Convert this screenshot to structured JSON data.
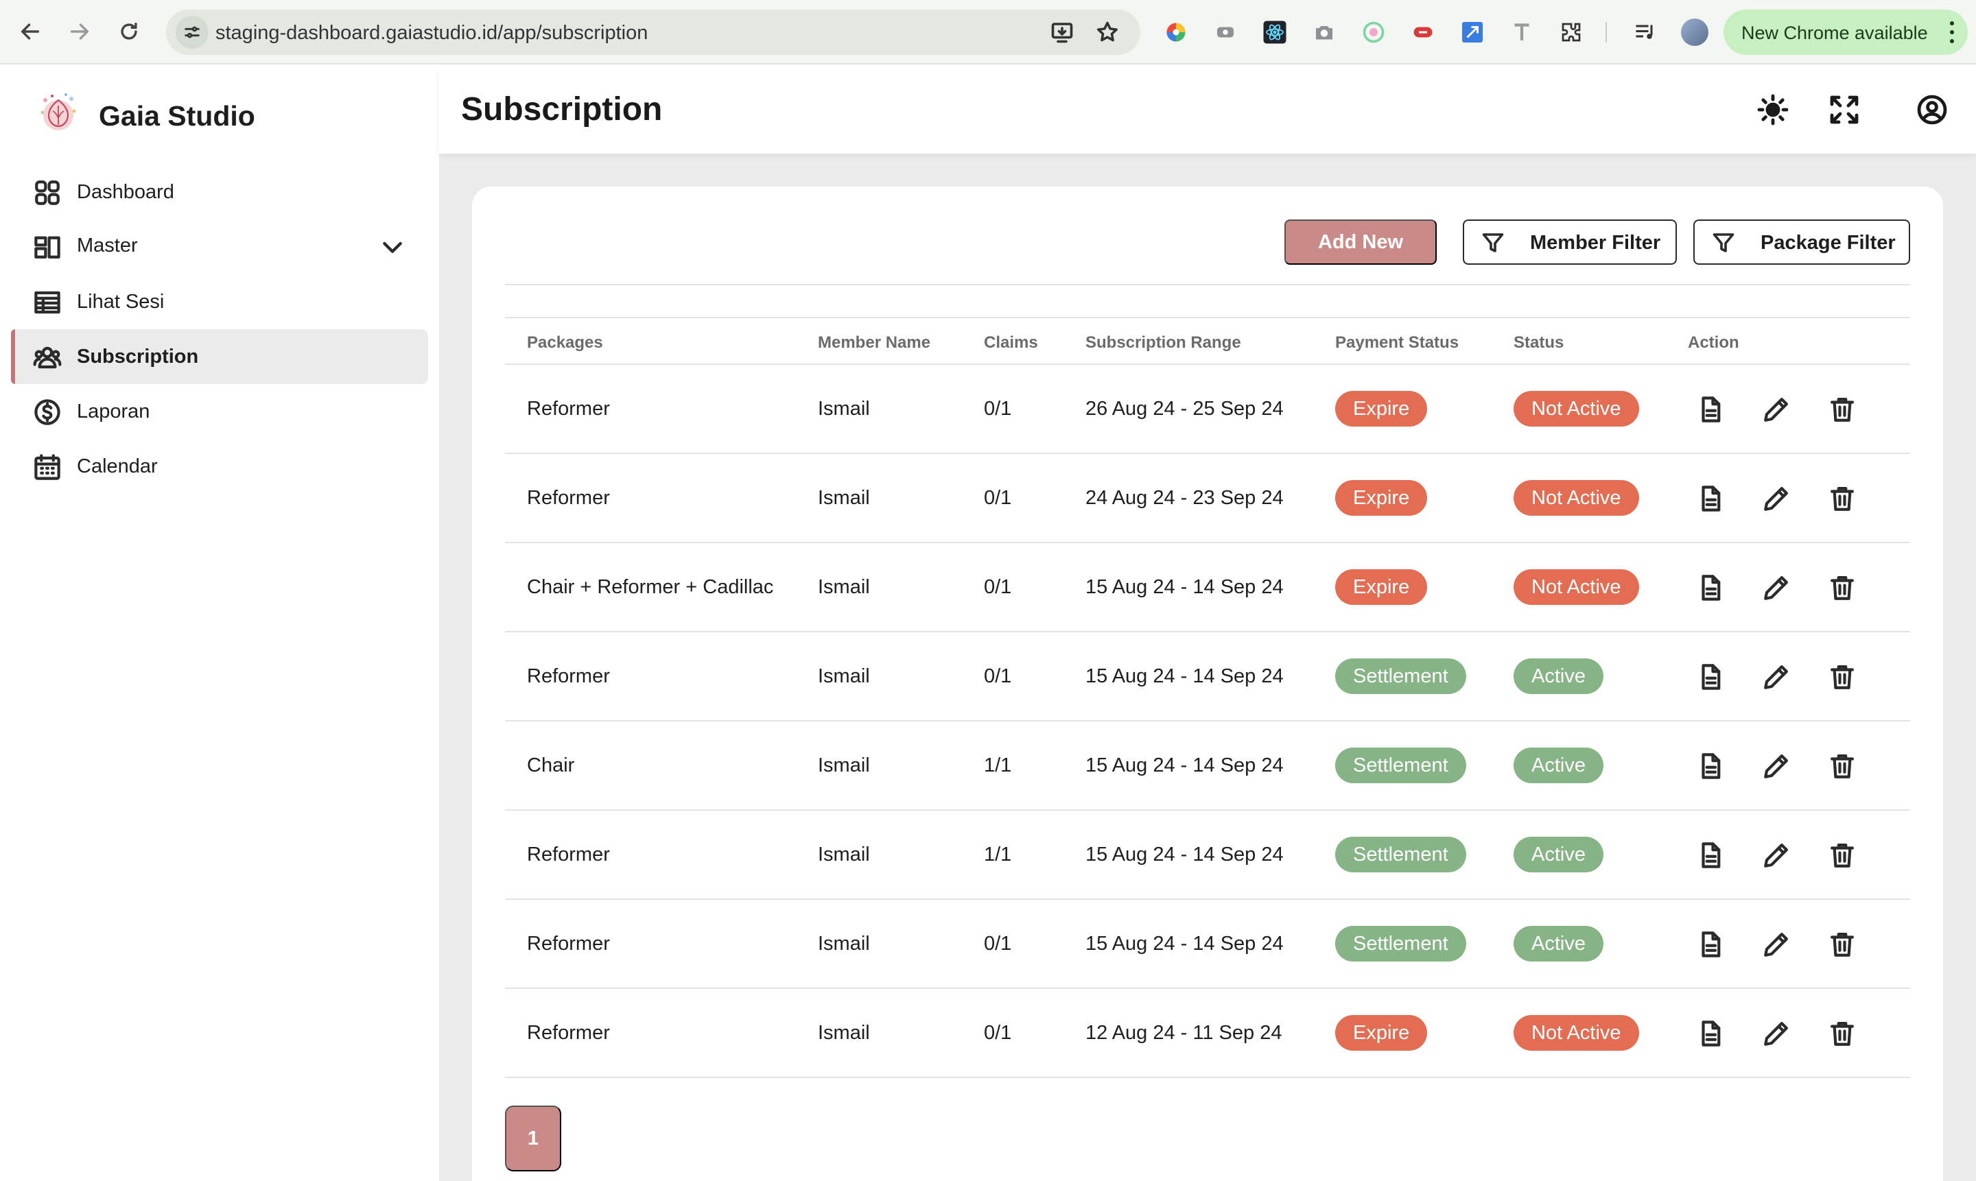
{
  "browser": {
    "url": "staging-dashboard.gaiastudio.id/app/subscription",
    "update_label": "New Chrome available"
  },
  "brand": {
    "name": "Gaia Studio"
  },
  "sidebar": {
    "items": [
      {
        "label": "Dashboard",
        "icon": "grid-icon"
      },
      {
        "label": "Master",
        "icon": "layout-icon"
      },
      {
        "label": "Lihat Sesi",
        "icon": "table-icon"
      },
      {
        "label": "Subscription",
        "icon": "users-icon"
      },
      {
        "label": "Laporan",
        "icon": "dollar-icon"
      },
      {
        "label": "Calendar",
        "icon": "calendar-icon"
      }
    ],
    "active": "Subscription"
  },
  "header": {
    "title": "Subscription"
  },
  "toolbar": {
    "add_label": "Add New",
    "member_filter_label": "Member Filter",
    "package_filter_label": "Package Filter"
  },
  "table": {
    "columns": [
      "Packages",
      "Member Name",
      "Claims",
      "Subscription Range",
      "Payment Status",
      "Status",
      "Action"
    ],
    "rows": [
      {
        "package": "Reformer",
        "member": "Ismail",
        "claims": "0/1",
        "range": "26 Aug 24 - 25 Sep 24",
        "payment": "Expire",
        "status": "Not Active"
      },
      {
        "package": "Reformer",
        "member": "Ismail",
        "claims": "0/1",
        "range": "24 Aug 24 - 23 Sep 24",
        "payment": "Expire",
        "status": "Not Active"
      },
      {
        "package": "Chair + Reformer + Cadillac",
        "member": "Ismail",
        "claims": "0/1",
        "range": "15 Aug 24 - 14 Sep 24",
        "payment": "Expire",
        "status": "Not Active"
      },
      {
        "package": "Reformer",
        "member": "Ismail",
        "claims": "0/1",
        "range": "15 Aug 24 - 14 Sep 24",
        "payment": "Settlement",
        "status": "Active"
      },
      {
        "package": "Chair",
        "member": "Ismail",
        "claims": "1/1",
        "range": "15 Aug 24 - 14 Sep 24",
        "payment": "Settlement",
        "status": "Active"
      },
      {
        "package": "Reformer",
        "member": "Ismail",
        "claims": "1/1",
        "range": "15 Aug 24 - 14 Sep 24",
        "payment": "Settlement",
        "status": "Active"
      },
      {
        "package": "Reformer",
        "member": "Ismail",
        "claims": "0/1",
        "range": "15 Aug 24 - 14 Sep 24",
        "payment": "Settlement",
        "status": "Active"
      },
      {
        "package": "Reformer",
        "member": "Ismail",
        "claims": "0/1",
        "range": "12 Aug 24 - 11 Sep 24",
        "payment": "Expire",
        "status": "Not Active"
      }
    ]
  },
  "pagination": {
    "current": "1"
  },
  "colors": {
    "accent": "#c98a88",
    "expire": "#e36d52",
    "settlement": "#86b486",
    "content_bg": "#ebebeb"
  }
}
